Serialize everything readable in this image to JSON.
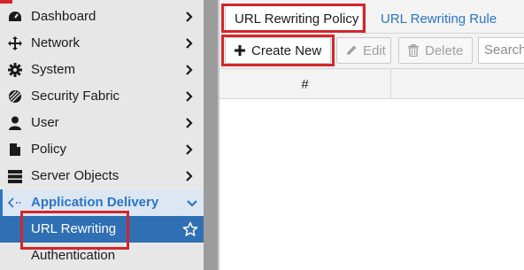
{
  "sidebar": {
    "items": [
      {
        "label": "Dashboard",
        "icon": "dashboard-icon"
      },
      {
        "label": "Network",
        "icon": "network-icon"
      },
      {
        "label": "System",
        "icon": "gear-icon"
      },
      {
        "label": "Security Fabric",
        "icon": "security-fabric-icon"
      },
      {
        "label": "User",
        "icon": "user-icon"
      },
      {
        "label": "Policy",
        "icon": "policy-icon"
      },
      {
        "label": "Server Objects",
        "icon": "server-icon"
      },
      {
        "label": "Application Delivery",
        "icon": "application-delivery-icon"
      },
      {
        "label": "URL Rewriting"
      },
      {
        "label": "Authentication"
      }
    ]
  },
  "tabs": {
    "active": "URL Rewriting Policy",
    "inactive": "URL Rewriting Rule"
  },
  "toolbar": {
    "create_label": "Create New",
    "edit_label": "Edit",
    "delete_label": "Delete",
    "search_placeholder": "Search"
  },
  "table": {
    "columns": [
      "#"
    ]
  },
  "colors": {
    "accent": "#2b74c6",
    "selected": "#2f6fb4",
    "highlight": "#d4262a"
  }
}
